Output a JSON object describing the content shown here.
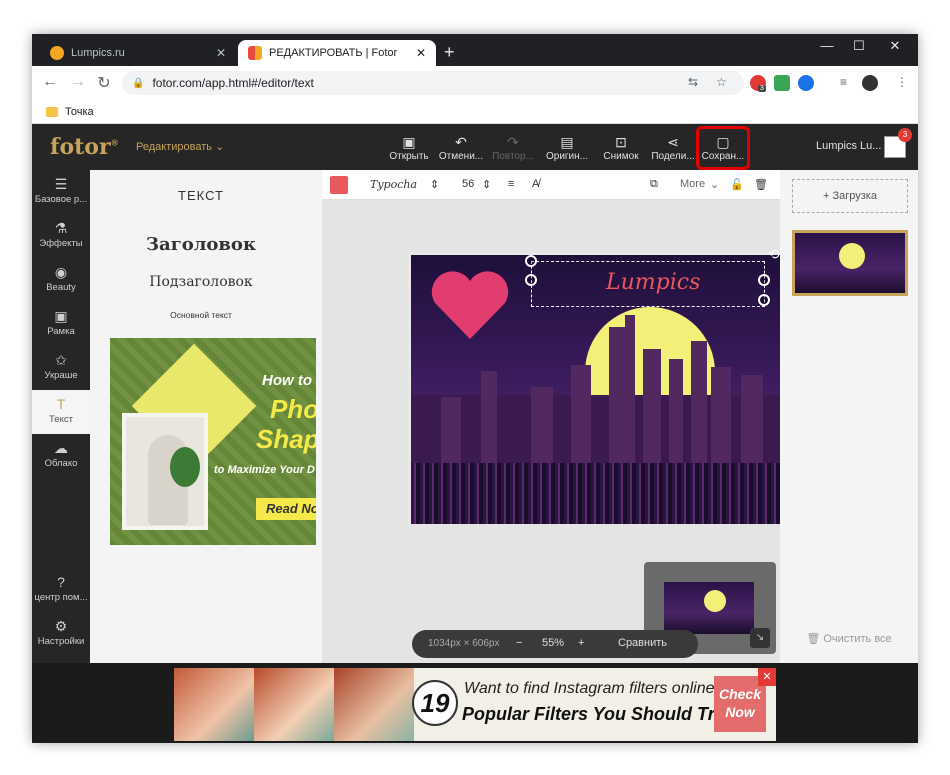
{
  "browser": {
    "tabs": [
      {
        "label": "Lumpics.ru",
        "active": false
      },
      {
        "label": "РЕДАКТИРОВАТЬ | Fotor",
        "active": true
      }
    ],
    "new_tab": "+",
    "url": "fotor.com/app.html#/editor/text",
    "bookmark": "Точка",
    "ext_badge": "3"
  },
  "app": {
    "logo": "fotor",
    "edit_menu": "Редактировать",
    "tools": [
      {
        "label": "Открыть",
        "icon": "open-image-icon",
        "enabled": true
      },
      {
        "label": "Отмени...",
        "icon": "undo-icon",
        "enabled": true
      },
      {
        "label": "Повтор...",
        "icon": "redo-icon",
        "enabled": false
      },
      {
        "label": "Оригин...",
        "icon": "original-icon",
        "enabled": true
      },
      {
        "label": "Снимок",
        "icon": "snapshot-icon",
        "enabled": true
      },
      {
        "label": "Подели...",
        "icon": "share-icon",
        "enabled": true
      },
      {
        "label": "Сохран...",
        "icon": "save-icon",
        "enabled": true
      }
    ],
    "user": "Lumpics Lu...",
    "notifications": "3",
    "highlight_color": "#e00000"
  },
  "sidenav": [
    {
      "label": "Базовое р...",
      "icon": "sliders-icon"
    },
    {
      "label": "Эффекты",
      "icon": "flask-icon"
    },
    {
      "label": "Beauty",
      "icon": "eye-icon"
    },
    {
      "label": "Рамка",
      "icon": "frame-icon"
    },
    {
      "label": "Украше",
      "icon": "sticker-icon"
    },
    {
      "label": "Текст",
      "icon": "text-icon",
      "active": true
    },
    {
      "label": "Облако",
      "icon": "cloud-icon"
    },
    {
      "label": "центр пом...",
      "icon": "help-icon"
    },
    {
      "label": "Настройки",
      "icon": "settings-icon"
    }
  ],
  "text_panel": {
    "title": "ТЕКСТ",
    "heading": "Заголовок",
    "subheading": "Подзаголовок",
    "body": "Основной текст",
    "promo": {
      "line1": "How to",
      "line2": "Pho",
      "line3": "Shap",
      "line4": "to Maximize Your D",
      "button": "Read No"
    }
  },
  "text_toolbar": {
    "color": "#e9585b",
    "font": "Typocha",
    "size": "56",
    "more": "More"
  },
  "canvas": {
    "text": "Lumpics",
    "dimensions": "1034px × 606px",
    "zoom": "55%",
    "compare": "Сравнить"
  },
  "right_panel": {
    "upload": "Загрузка",
    "clear_all": "Очистить все"
  },
  "ad": {
    "number": "19",
    "line1": "Want to find Instagram filters online?",
    "line2": "Popular Filters You Should Try",
    "cta": "Check Now"
  }
}
